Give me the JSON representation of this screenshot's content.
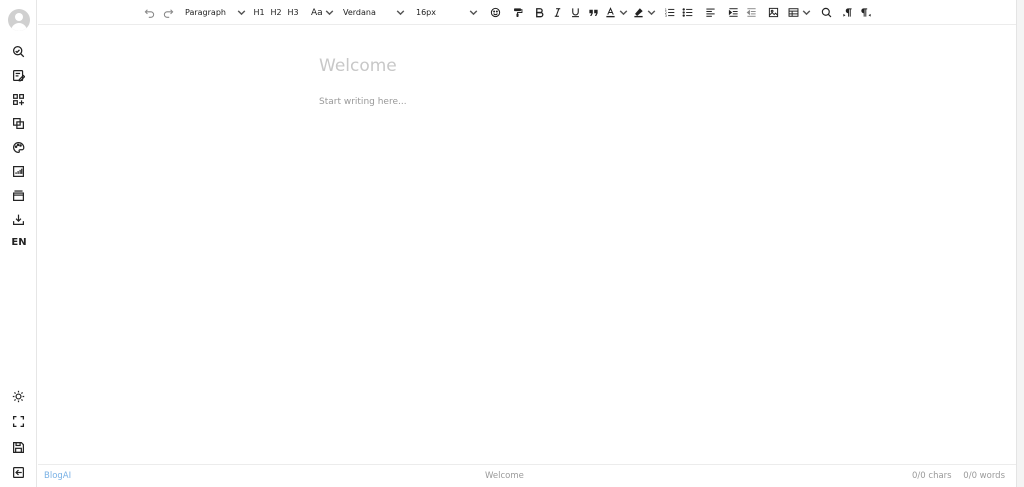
{
  "toolbar": {
    "block_style": "Paragraph",
    "h1": "H1",
    "h2": "H2",
    "h3": "H3",
    "case_label": "Aa",
    "font_family": "Verdana",
    "font_size": "16px"
  },
  "sidebar": {
    "language": "EN"
  },
  "editor": {
    "title_placeholder": "Welcome",
    "body_placeholder": "Start writing here..."
  },
  "status": {
    "brand": "BlogAI",
    "title": "Welcome",
    "chars": "0/0 chars",
    "words": "0/0 words"
  },
  "colors": {
    "accent": "#79b1e5",
    "text": "#222222",
    "muted": "#9a9a9a"
  }
}
